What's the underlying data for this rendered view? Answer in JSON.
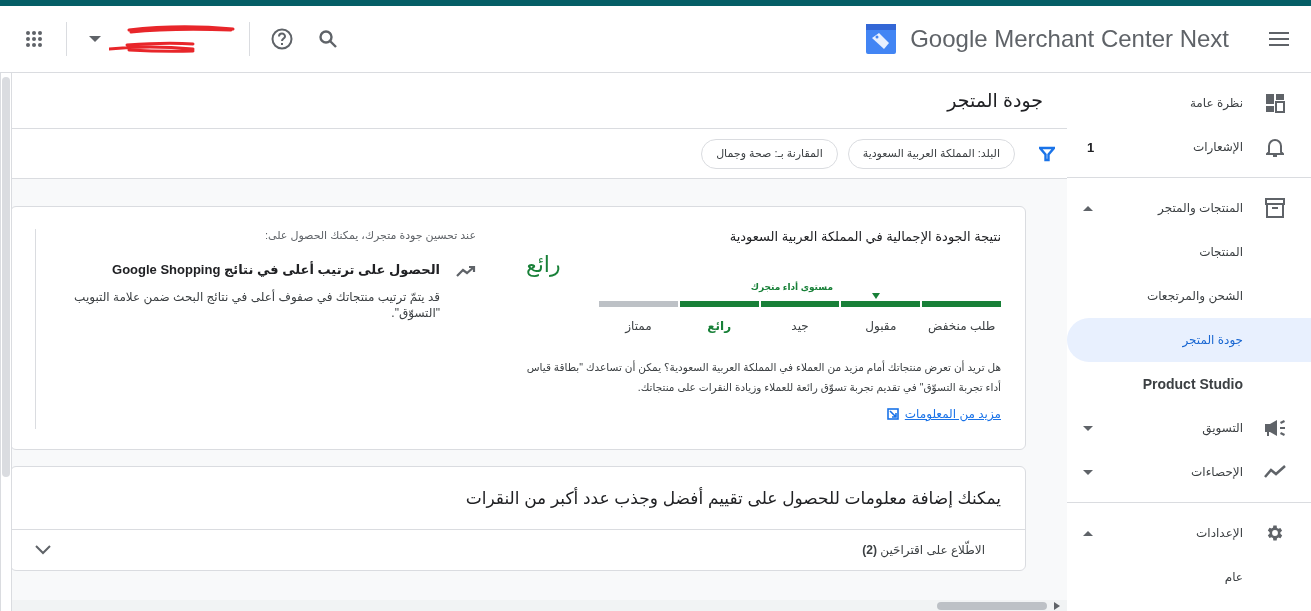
{
  "header": {
    "product_name": "Google Merchant Center Next"
  },
  "page": {
    "title": "جودة المتجر"
  },
  "filters": [
    {
      "label": "البلد: المملكة العربية السعودية"
    },
    {
      "label": "المقارنة بـ: صحة وجمال"
    }
  ],
  "quality_card": {
    "title": "نتيجة الجودة الإجمالية في المملكة العربية السعودية",
    "rating": "رائع",
    "marker_label": "مستوى أداء متجرك",
    "scale": [
      {
        "label": "طلب منخفض",
        "filled": true,
        "selected": false,
        "marked": false
      },
      {
        "label": "مقبول",
        "filled": true,
        "selected": false,
        "marked": true
      },
      {
        "label": "جيد",
        "filled": true,
        "selected": false,
        "marked": false
      },
      {
        "label": "رائع",
        "filled": true,
        "selected": true,
        "marked": false
      },
      {
        "label": "ممتاز",
        "filled": false,
        "selected": false,
        "marked": false
      }
    ],
    "body": "هل تريد أن تعرض منتجاتك أمام مزيد من العملاء في المملكة العربية السعودية؟ يمكن أن تساعدك \"بطاقة قياس أداء تجربة التسوّق\" في تقديم تجربة تسوّق رائعة للعملاء وزيادة النقرات على منتجاتك.",
    "link": "مزيد من المعلومات"
  },
  "benefits": {
    "intro": "عند تحسين جودة متجرك، يمكنك الحصول على:",
    "items": [
      {
        "title": "الحصول على ترتيب أعلى في نتائج Google Shopping",
        "description": "قد يتمّ ترتيب منتجاتك في صفوف أعلى في نتائج البحث ضمن علامة التبويب \"التسوّق\"."
      }
    ]
  },
  "suggestions_card": {
    "title": "يمكنك إضافة معلومات للحصول على تقييم أفضل وجذب عدد أكبر من النقرات",
    "toggle": "الاطّلاع على اقتراحَين **(2)**",
    "expanded": false
  },
  "sidebar": {
    "sections": [
      [
        {
          "label": "نظرة عامة",
          "kind": "top",
          "selected": false
        },
        {
          "label": "الإشعارات",
          "kind": "top",
          "selected": false,
          "badge": "1"
        }
      ],
      [
        {
          "label": "المنتجات والمتجر",
          "kind": "top",
          "selected": false,
          "expanded": true
        },
        {
          "label": "المنتجات",
          "kind": "sub",
          "selected": false
        },
        {
          "label": "الشحن والمرتجعات",
          "kind": "sub",
          "selected": false
        },
        {
          "label": "جودة المتجر",
          "kind": "sub",
          "selected": true
        },
        {
          "label": "Product Studio",
          "kind": "plain",
          "selected": false
        },
        {
          "label": "التسويق",
          "kind": "top",
          "selected": false,
          "expanded": false
        },
        {
          "label": "الإحصاءات",
          "kind": "top",
          "selected": false,
          "expanded": false
        }
      ],
      [
        {
          "label": "الإعدادات",
          "kind": "top",
          "selected": false,
          "expanded": true
        },
        {
          "label": "عام",
          "kind": "sub",
          "selected": false
        }
      ]
    ]
  }
}
